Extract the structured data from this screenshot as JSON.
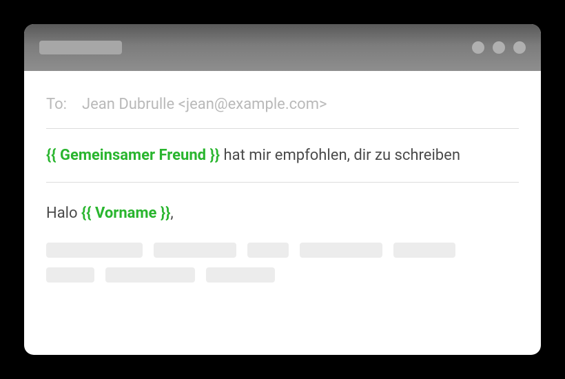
{
  "compose": {
    "to_label": "To:",
    "to_value": "Jean Dubrulle <jean@example.com>",
    "subject": {
      "var_open": "{{",
      "var_name": "Gemeinsamer Freund",
      "var_close": "}}",
      "suffix": " hat mir empfohlen, dir zu schreiben"
    },
    "body": {
      "greeting_prefix": "Halo ",
      "var_open": "{{",
      "var_name": "Vorname",
      "var_close": "}}",
      "greeting_suffix": ","
    }
  },
  "colors": {
    "template_var": "#29b52e",
    "muted_text": "#b9b9b9",
    "body_text": "#4a4a4a"
  }
}
